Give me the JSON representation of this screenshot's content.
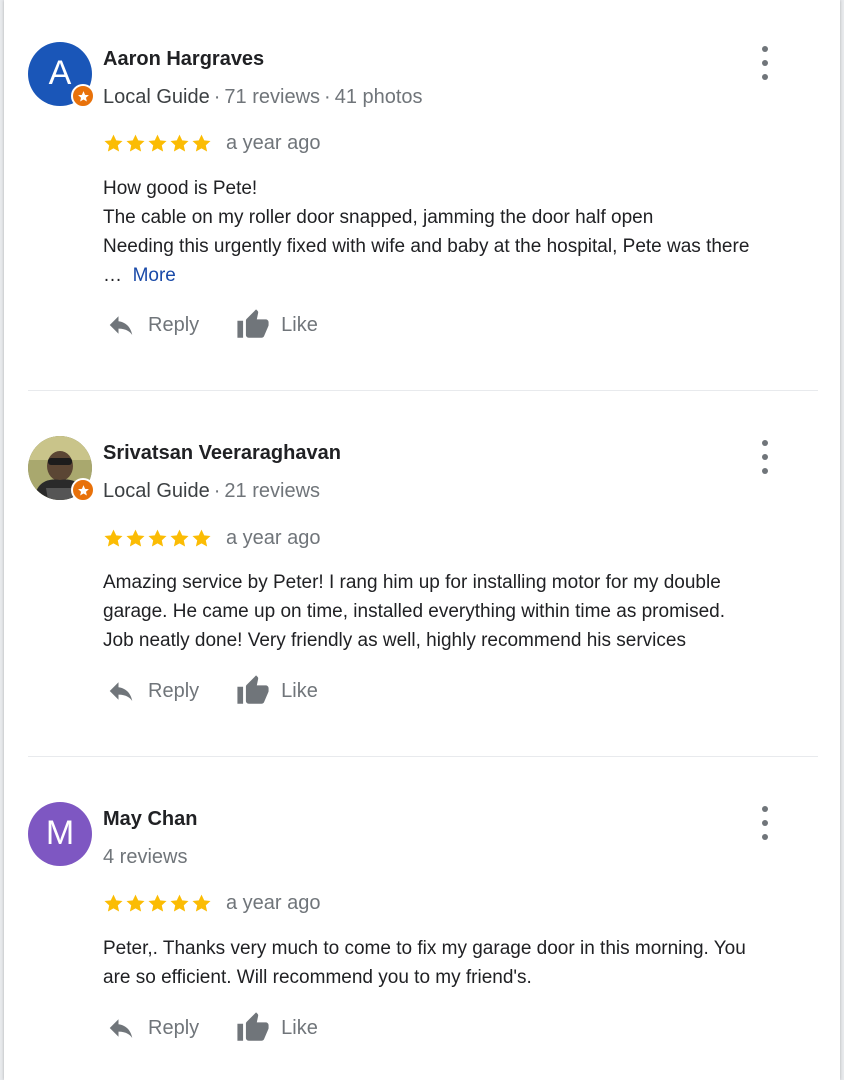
{
  "colors": {
    "star": "#fbbc04",
    "badge": "#e8710a",
    "link": "#1a4aa8",
    "meta": "#70757a"
  },
  "actions": {
    "reply_label": "Reply",
    "like_label": "Like",
    "more_label": "More",
    "menu_icon": "more-vert-icon"
  },
  "reviews": [
    {
      "avatar_letter": "A",
      "avatar_color": "#1a56b8",
      "name": "Aaron Hargraves",
      "local_guide": "Local Guide",
      "reviews_count": "71 reviews",
      "photos_count": "41 photos",
      "rating": 5,
      "time": "a year ago",
      "lines": [
        "How good is Pete!",
        "The cable on my roller door snapped, jamming the door half open",
        "Needing this urgently fixed with wife and baby at the hospital, Pete was there"
      ],
      "ellipsis": "…"
    },
    {
      "avatar_letter": "",
      "name": "Srivatsan Veeraraghavan",
      "local_guide": "Local Guide",
      "reviews_count": "21 reviews",
      "rating": 5,
      "time": "a year ago",
      "lines": [
        "Amazing service by Peter! I rang him up for installing motor for my double",
        "garage. He came up on time, installed everything within time as promised.",
        "Job neatly done! Very friendly as well, highly recommend his services"
      ]
    },
    {
      "avatar_letter": "M",
      "avatar_color": "#7e57c2",
      "name": "May Chan",
      "reviews_count": "4 reviews",
      "rating": 5,
      "time": "a year ago",
      "lines": [
        "Peter,. Thanks very much to come to fix my garage door in this morning. You",
        "are so efficient. Will recommend you to my friend's."
      ]
    }
  ]
}
